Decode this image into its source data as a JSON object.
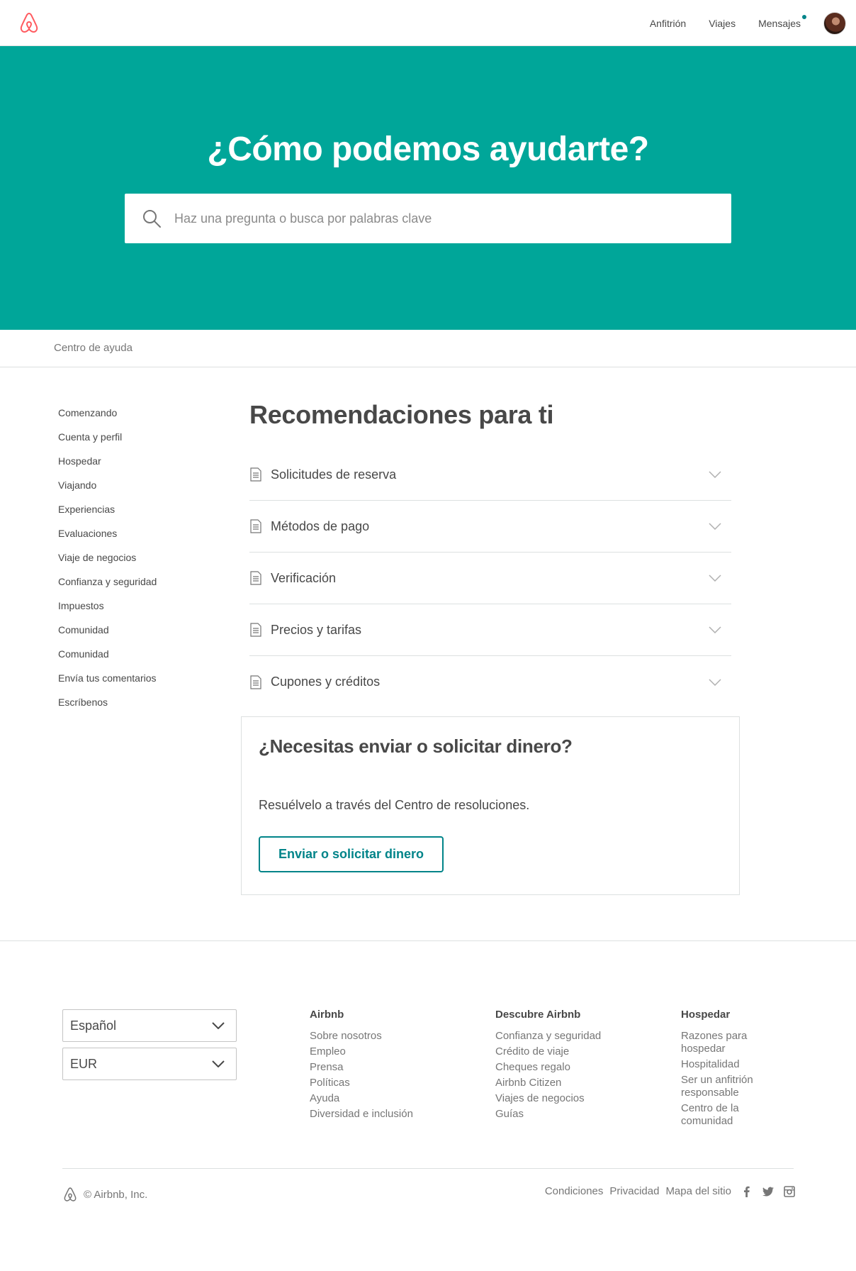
{
  "header": {
    "logo_name": "airbnb-logo",
    "nav": [
      {
        "label": "Anfitrión"
      },
      {
        "label": "Viajes"
      },
      {
        "label": "Mensajes"
      }
    ]
  },
  "hero": {
    "title": "¿Cómo podemos ayudarte?",
    "search_placeholder": "Haz una pregunta o busca por palabras clave"
  },
  "breadcrumb": "Centro de ayuda",
  "sidebar": {
    "items": [
      {
        "label": "Comenzando"
      },
      {
        "label": "Cuenta y perfil"
      },
      {
        "label": "Hospedar"
      },
      {
        "label": "Viajando"
      },
      {
        "label": "Experiencias"
      },
      {
        "label": "Evaluaciones"
      },
      {
        "label": "Viaje de negocios"
      },
      {
        "label": "Confianza y seguridad"
      },
      {
        "label": "Impuestos"
      },
      {
        "label": "Comunidad"
      },
      {
        "label": "Comunidad"
      },
      {
        "label": "Envía tus comentarios"
      },
      {
        "label": "Escríbenos"
      }
    ]
  },
  "main": {
    "title": "Recomendaciones para ti",
    "topics": [
      {
        "label": "Solicitudes de reserva"
      },
      {
        "label": "Métodos de pago"
      },
      {
        "label": "Verificación"
      },
      {
        "label": "Precios y tarifas"
      },
      {
        "label": "Cupones y créditos"
      }
    ]
  },
  "card": {
    "title": "¿Necesitas enviar o solicitar dinero?",
    "text": "Resuélvelo a través del Centro de resoluciones.",
    "button": "Enviar o solicitar dinero"
  },
  "footer": {
    "language": "Español",
    "currency": "EUR",
    "columns": [
      {
        "title": "Airbnb",
        "links": [
          "Sobre nosotros",
          "Empleo",
          "Prensa",
          "Políticas",
          "Ayuda",
          "Diversidad e inclusión"
        ]
      },
      {
        "title": "Descubre Airbnb",
        "links": [
          "Confianza y seguridad",
          "Crédito de viaje",
          "Cheques regalo",
          "Airbnb Citizen",
          "Viajes de negocios",
          "Guías"
        ]
      },
      {
        "title": "Hospedar",
        "links": [
          "Razones para hospedar",
          "Hospitalidad",
          "Ser un anfitrión responsable",
          "Centro de la comunidad"
        ]
      }
    ],
    "copyright": "© Airbnb, Inc.",
    "legal": [
      "Condiciones",
      "Privacidad",
      "Mapa del sitio"
    ],
    "social": [
      "facebook-icon",
      "twitter-icon",
      "instagram-icon"
    ]
  },
  "colors": {
    "brand": "#FF5A5F",
    "hero_bg": "#00A699",
    "accent": "#008489",
    "text": "#484848"
  }
}
